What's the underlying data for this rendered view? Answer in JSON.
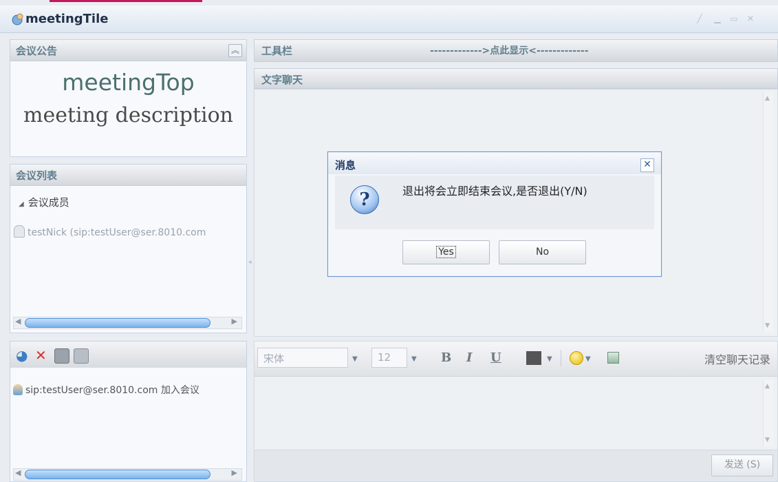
{
  "window": {
    "title": "meetingTile"
  },
  "announcement": {
    "header": "会议公告",
    "meeting_top": "meetingTop",
    "meeting_description": "meeting description"
  },
  "meeting_list": {
    "header": "会议列表",
    "group_label": "会议成员",
    "members": [
      "testNick (sip:testUser@ser.8010.com"
    ]
  },
  "log_panel": {
    "entries": [
      "sip:testUser@ser.8010.com 加入会议"
    ]
  },
  "toolbar": {
    "label": "工具栏",
    "hint": "------------->点此显示<-------------"
  },
  "chat": {
    "header": "文字聊天",
    "font_name": "宋体",
    "font_size": "12",
    "bold_glyph": "B",
    "italic_glyph": "I",
    "underline_glyph": "U",
    "clear_label": "清空聊天记录",
    "send_label": "发送 (S)"
  },
  "dialog": {
    "title": "消息",
    "message": "退出将会立即结束会议,是否退出(Y/N)",
    "yes_label": "Yes",
    "no_label": "No"
  },
  "icons": {
    "window_logo": "globe-person-icon",
    "collapse": "double-chevron-up-icon",
    "question": "question-icon"
  },
  "colors": {
    "accent_strip": "#c2185b",
    "header_text": "#5f7f8f",
    "dialog_border": "#6d96cf"
  }
}
